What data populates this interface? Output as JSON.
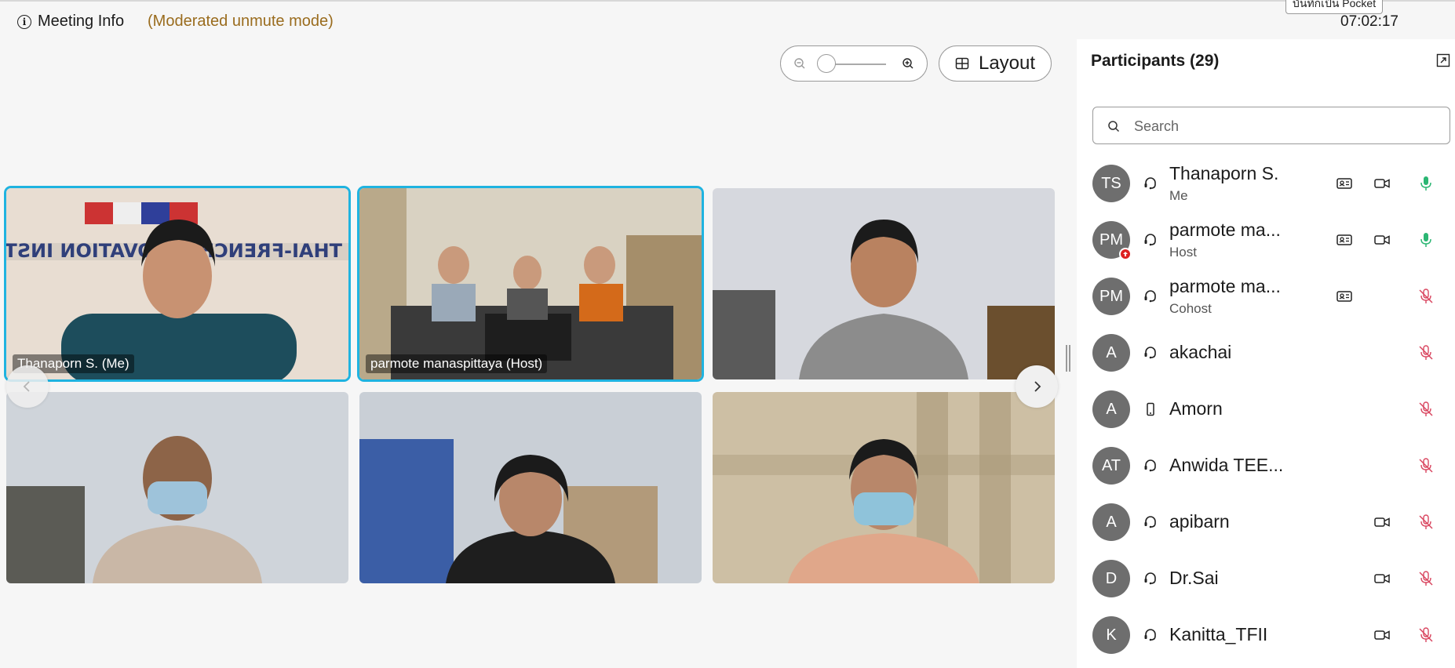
{
  "header": {
    "meeting_info_label": "Meeting Info",
    "mode_label": "(Moderated unmute mode)",
    "clock": "07:02:17",
    "tooltip": "บันทึกเป็น Pocket"
  },
  "controls": {
    "layout_label": "Layout"
  },
  "video_tiles": [
    {
      "name": "Thanaporn S. (Me)",
      "active": true
    },
    {
      "name": "parmote manaspittaya (Host)",
      "active": true
    },
    {
      "name": "",
      "active": false
    },
    {
      "name": "",
      "active": false
    },
    {
      "name": "",
      "active": false
    },
    {
      "name": "",
      "active": false
    }
  ],
  "participants": {
    "title": "Participants (29)",
    "search_placeholder": "Search",
    "list": [
      {
        "initials": "TS",
        "name": "Thanaporn S.",
        "role": "Me",
        "conn": "headset",
        "card": true,
        "camera": true,
        "mic": "on"
      },
      {
        "initials": "PM",
        "name": "parmote ma...",
        "role": "Host",
        "conn": "headset",
        "card": true,
        "camera": true,
        "mic": "on",
        "badge": true
      },
      {
        "initials": "PM",
        "name": "parmote ma...",
        "role": "Cohost",
        "conn": "headset",
        "card": true,
        "camera": false,
        "mic": "muted"
      },
      {
        "initials": "A",
        "name": "akachai",
        "role": "",
        "conn": "headset",
        "card": false,
        "camera": false,
        "mic": "muted"
      },
      {
        "initials": "A",
        "name": "Amorn",
        "role": "",
        "conn": "phone",
        "card": false,
        "camera": false,
        "mic": "muted"
      },
      {
        "initials": "AT",
        "name": "Anwida TEE...",
        "role": "",
        "conn": "headset",
        "card": false,
        "camera": false,
        "mic": "muted"
      },
      {
        "initials": "A",
        "name": "apibarn",
        "role": "",
        "conn": "headset",
        "card": false,
        "camera": true,
        "mic": "muted"
      },
      {
        "initials": "D",
        "name": "Dr.Sai",
        "role": "",
        "conn": "headset",
        "card": false,
        "camera": true,
        "mic": "muted"
      },
      {
        "initials": "K",
        "name": "Kanitta_TFII",
        "role": "",
        "conn": "headset",
        "card": false,
        "camera": true,
        "mic": "muted"
      }
    ]
  },
  "colors": {
    "active_border": "#1fb3e0",
    "mode_text": "#9a6c1e",
    "mic_on": "#2bb673",
    "mic_muted": "#d9455f"
  }
}
